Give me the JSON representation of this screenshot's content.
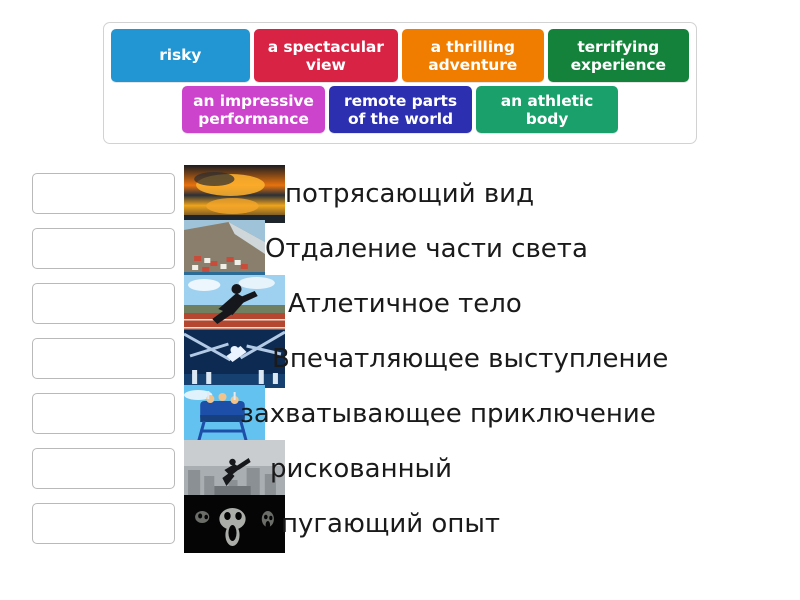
{
  "word_bank": {
    "rows": [
      {
        "tiles": [
          {
            "label": "risky",
            "color": "#2196d3",
            "lines": 1
          },
          {
            "label": "a spectacular\nview",
            "color": "#d92344",
            "lines": 2
          },
          {
            "label": "a thrilling\nadventure",
            "color": "#f07c00",
            "lines": 2
          },
          {
            "label": "terrifying\nexperience",
            "color": "#14823b",
            "lines": 2
          }
        ]
      },
      {
        "tiles": [
          {
            "label": "an impressive\nperformance",
            "color": "#cc44cc",
            "lines": 2
          },
          {
            "label": "remote parts\nof the world",
            "color": "#2b2fb0",
            "lines": 2
          },
          {
            "label": "an athletic\nbody",
            "color": "#19a06b",
            "lines": 2
          }
        ]
      }
    ]
  },
  "answers": [
    {
      "text": "потрясающий вид",
      "thumb": "sunset-reflection-thumb",
      "text_left": 285,
      "narrow": false
    },
    {
      "text": "Отдаление части света",
      "thumb": "remote-village-thumb",
      "text_left": 265,
      "narrow": true
    },
    {
      "text": "Атлетичное тело",
      "thumb": "sprinter-track-thumb",
      "text_left": 288,
      "narrow": false
    },
    {
      "text": "Впечатляющее выступление",
      "thumb": "stage-performance-thumb",
      "text_left": 272,
      "narrow": false
    },
    {
      "text": "захватывающее приключение",
      "thumb": "roller-coaster-thumb",
      "text_left": 240,
      "narrow": true
    },
    {
      "text": "рискованный",
      "thumb": "rooftop-stunt-thumb",
      "text_left": 270,
      "narrow": false
    },
    {
      "text": "пугающий опыт",
      "thumb": "ghost-faces-thumb",
      "text_left": 281,
      "narrow": false
    }
  ],
  "drop_box_placeholder": ""
}
